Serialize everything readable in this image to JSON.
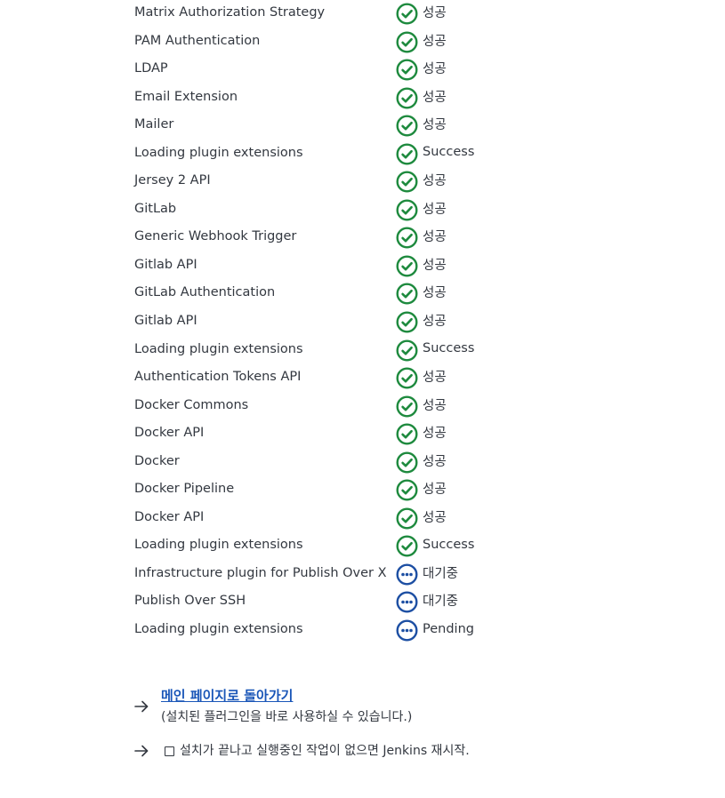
{
  "plugins": [
    {
      "name": "Matrix Authorization Strategy",
      "status": "success",
      "status_label": "성공"
    },
    {
      "name": "PAM Authentication",
      "status": "success",
      "status_label": "성공"
    },
    {
      "name": "LDAP",
      "status": "success",
      "status_label": "성공"
    },
    {
      "name": "Email Extension",
      "status": "success",
      "status_label": "성공"
    },
    {
      "name": "Mailer",
      "status": "success",
      "status_label": "성공"
    },
    {
      "name": "Loading plugin extensions",
      "status": "success",
      "status_label": "Success"
    },
    {
      "name": "Jersey 2 API",
      "status": "success",
      "status_label": "성공"
    },
    {
      "name": "GitLab",
      "status": "success",
      "status_label": "성공"
    },
    {
      "name": "Generic Webhook Trigger",
      "status": "success",
      "status_label": "성공"
    },
    {
      "name": "Gitlab API",
      "status": "success",
      "status_label": "성공"
    },
    {
      "name": "GitLab Authentication",
      "status": "success",
      "status_label": "성공"
    },
    {
      "name": "Gitlab API",
      "status": "success",
      "status_label": "성공"
    },
    {
      "name": "Loading plugin extensions",
      "status": "success",
      "status_label": "Success"
    },
    {
      "name": "Authentication Tokens API",
      "status": "success",
      "status_label": "성공"
    },
    {
      "name": "Docker Commons",
      "status": "success",
      "status_label": "성공"
    },
    {
      "name": "Docker API",
      "status": "success",
      "status_label": "성공"
    },
    {
      "name": "Docker",
      "status": "success",
      "status_label": "성공"
    },
    {
      "name": "Docker Pipeline",
      "status": "success",
      "status_label": "성공"
    },
    {
      "name": "Docker API",
      "status": "success",
      "status_label": "성공"
    },
    {
      "name": "Loading plugin extensions",
      "status": "success",
      "status_label": "Success"
    },
    {
      "name": "Infrastructure plugin for Publish Over X",
      "status": "pending",
      "status_label": "대기중"
    },
    {
      "name": "Publish Over SSH",
      "status": "pending",
      "status_label": "대기중"
    },
    {
      "name": "Loading plugin extensions",
      "status": "pending",
      "status_label": "Pending"
    }
  ],
  "colors": {
    "success": "#1e8a3e",
    "pending": "#1d4fa3",
    "link": "#1a56b8"
  },
  "actions": {
    "main_page_link": "메인 페이지로 돌아가기",
    "main_page_sub": "(설치된 플러그인을 바로 사용하실 수 있습니다.)",
    "restart_label": "설치가 끝나고 실행중인 작업이 없으면 Jenkins 재시작."
  },
  "icons": {
    "success": "check-circle-icon",
    "pending": "ellipsis-circle-icon",
    "arrow": "arrow-right-icon"
  }
}
